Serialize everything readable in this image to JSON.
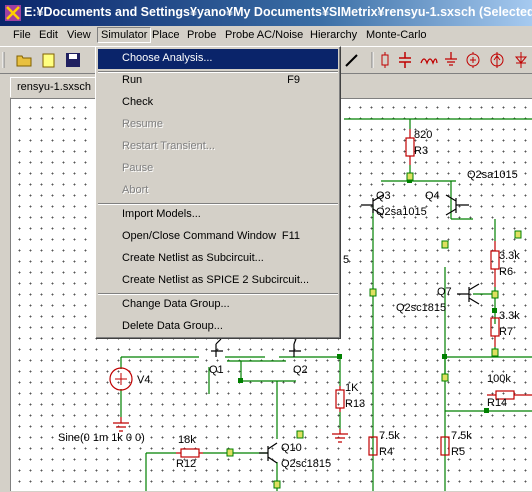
{
  "window": {
    "title": "E:¥Documents and Settings¥yano¥My Documents¥SIMetrix¥rensyu-1.sxsch (Selected)"
  },
  "menubar": {
    "items": [
      {
        "label": "File",
        "name": "menu-file"
      },
      {
        "label": "Edit",
        "name": "menu-edit"
      },
      {
        "label": "View",
        "name": "menu-view"
      },
      {
        "label": "Simulator",
        "name": "menu-simulator"
      },
      {
        "label": "Place",
        "name": "menu-place"
      },
      {
        "label": "Probe",
        "name": "menu-probe"
      },
      {
        "label": "Probe AC/Noise",
        "name": "menu-probe-ac-noise"
      },
      {
        "label": "Hierarchy",
        "name": "menu-hierarchy"
      },
      {
        "label": "Monte-Carlo",
        "name": "menu-monte-carlo"
      }
    ]
  },
  "tabs": [
    {
      "label": "rensyu-1.sxsch"
    }
  ],
  "simulator_menu": {
    "items": [
      {
        "label": "Choose Analysis...",
        "shortcut": "",
        "state": "selected"
      },
      {
        "label": "Run",
        "shortcut": "F9",
        "state": "enabled"
      },
      {
        "label": "Check",
        "shortcut": "",
        "state": "enabled"
      },
      {
        "label": "Resume",
        "shortcut": "",
        "state": "disabled"
      },
      {
        "label": "Restart Transient...",
        "shortcut": "",
        "state": "disabled"
      },
      {
        "label": "Pause",
        "shortcut": "",
        "state": "disabled"
      },
      {
        "label": "Abort",
        "shortcut": "",
        "state": "disabled"
      },
      {
        "label": "Import Models...",
        "shortcut": "",
        "state": "enabled"
      },
      {
        "label": "Open/Close Command Window",
        "shortcut": "F11",
        "state": "enabled"
      },
      {
        "label": "Create Netlist as Subcircuit...",
        "shortcut": "",
        "state": "enabled"
      },
      {
        "label": "Create Netlist as SPICE 2 Subcircuit...",
        "shortcut": "",
        "state": "enabled"
      },
      {
        "label": "Change Data Group...",
        "shortcut": "",
        "state": "enabled"
      },
      {
        "label": "Delete Data Group...",
        "shortcut": "",
        "state": "enabled"
      }
    ]
  },
  "schematic": {
    "labels": {
      "r3_value": "820",
      "r3": "R3",
      "q2sa1015_top": "Q2sa1015",
      "q3": "Q3",
      "q4": "Q4",
      "q3q4_model": "Q2sa1015",
      "r6_value": "3.3k",
      "r6": "R6",
      "q7": "Q7",
      "q7_model": "Q2sc1815",
      "r7_value": "3.3k",
      "r7": "R7",
      "stray_5": "5",
      "v4": "V4",
      "q1": "Q1",
      "q2": "Q2",
      "r13_value": "1K",
      "r13": "R13",
      "r14_value": "100k",
      "r14": "R14",
      "sine": "Sine(0 1m 1k 0 0)",
      "r12_value": "18k",
      "r12": "R12",
      "q10": "Q10",
      "q10_model": "Q2sc1815",
      "r4_value": "7.5k",
      "r4": "R4",
      "r5_value": "7.5k",
      "r5": "R5"
    }
  },
  "colors": {
    "wire": "#008000",
    "component": "#c00000",
    "junction": "#008000",
    "selection": "#0a246a"
  }
}
